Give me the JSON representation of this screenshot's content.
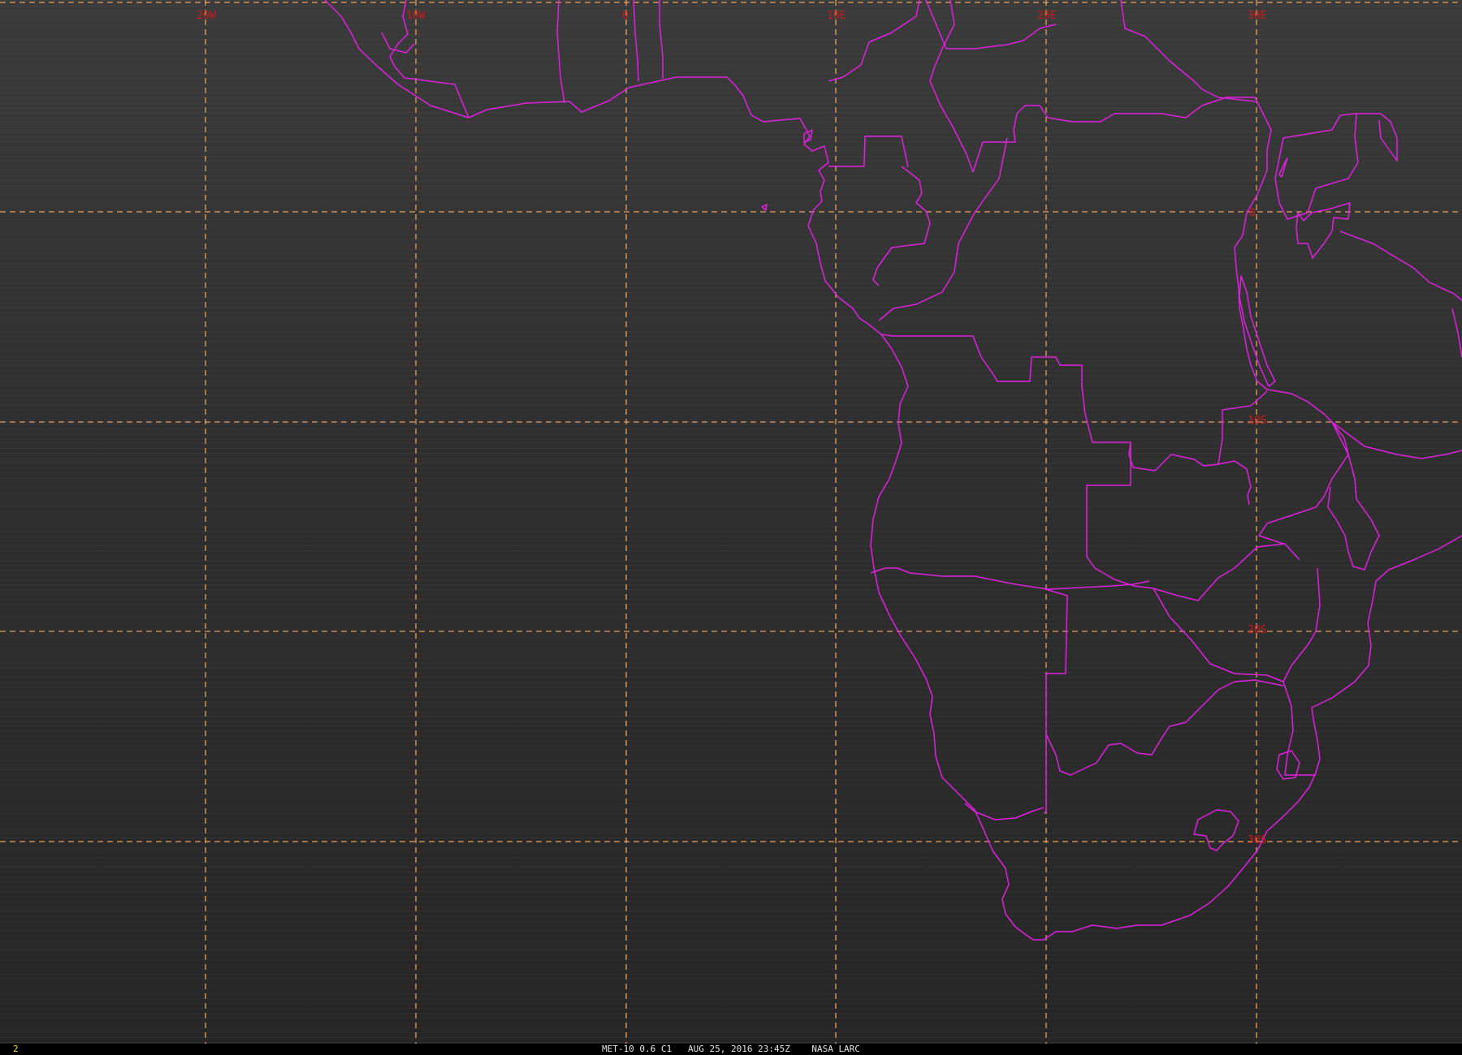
{
  "map": {
    "longitude_labels": [
      "20W",
      "10W",
      "0",
      "10E",
      "20E",
      "30E"
    ],
    "latitude_labels": [
      "0",
      "10S",
      "20S",
      "30S"
    ],
    "grid_color": "#e8a060",
    "border_color": "#e020e0",
    "label_color": "#cc1b1b"
  },
  "status_bar": {
    "frame_number": "2",
    "caption": "MET-10 0.6 C1   AUG 25, 2016 23:45Z    NASA LARC"
  }
}
